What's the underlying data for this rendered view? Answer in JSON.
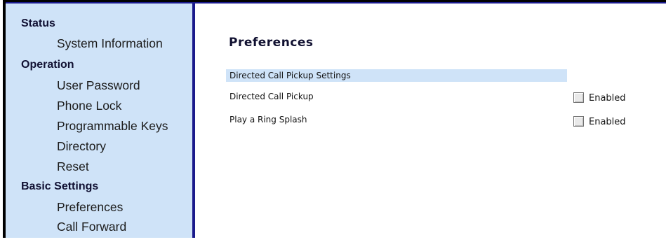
{
  "sidebar": {
    "sections": [
      {
        "title": "Status",
        "items": [
          "System Information"
        ]
      },
      {
        "title": "Operation",
        "items": [
          "User Password",
          "Phone Lock",
          "Programmable Keys",
          "Directory",
          "Reset"
        ]
      },
      {
        "title": "Basic Settings",
        "items": [
          "Preferences",
          "Call Forward"
        ]
      }
    ]
  },
  "main": {
    "title": "Preferences",
    "section_header": "Directed Call Pickup Settings",
    "settings": [
      {
        "label": "Directed Call Pickup",
        "checkbox_label": "Enabled",
        "checked": false
      },
      {
        "label": "Play a Ring Splash",
        "checkbox_label": "Enabled",
        "checked": false
      }
    ]
  },
  "colors": {
    "sidebar_bg": "#cfe3f8",
    "frame_border": "#1a1a8c",
    "section_bar_bg": "#cfe3f8"
  }
}
